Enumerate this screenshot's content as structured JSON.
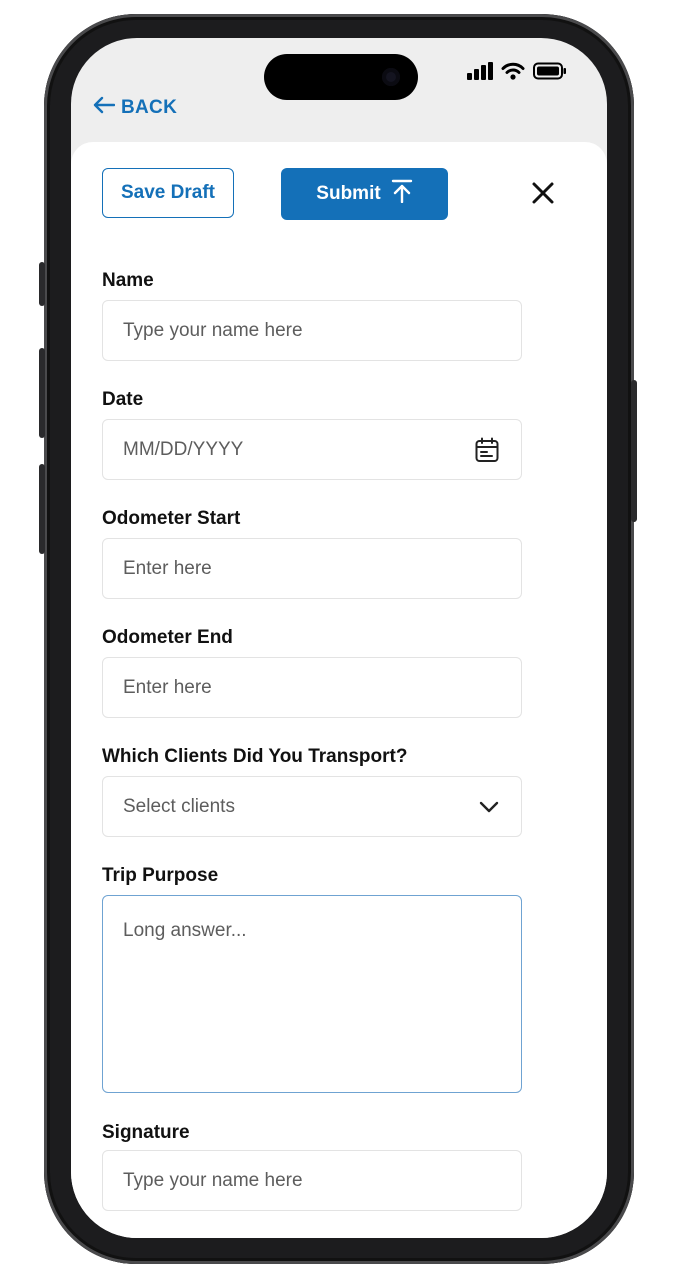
{
  "header": {
    "back_label": "BACK"
  },
  "toolbar": {
    "save_label": "Save Draft",
    "submit_label": "Submit"
  },
  "form": {
    "name": {
      "label": "Name",
      "placeholder": "Type your name here"
    },
    "date": {
      "label": "Date",
      "placeholder": "MM/DD/YYYY"
    },
    "odometer_start": {
      "label": "Odometer Start",
      "placeholder": "Enter here"
    },
    "odometer_end": {
      "label": "Odometer End",
      "placeholder": "Enter here"
    },
    "clients": {
      "label": "Which Clients Did You Transport?",
      "placeholder": "Select clients"
    },
    "trip_purpose": {
      "label": "Trip Purpose",
      "placeholder": "Long answer..."
    },
    "signature": {
      "label": "Signature",
      "placeholder": "Type your name here"
    }
  },
  "icons": {
    "back": "arrow-left-icon",
    "submit": "upload-icon",
    "close": "close-icon",
    "date": "calendar-icon",
    "clients": "chevron-down-icon",
    "status": [
      "signal-icon",
      "wifi-icon",
      "battery-icon"
    ]
  },
  "colors": {
    "accent": "#1470b8",
    "text": "#111111",
    "placeholder": "#5d5d5d",
    "border": "#e3e3e3",
    "focus_border": "#6fa3d2"
  }
}
